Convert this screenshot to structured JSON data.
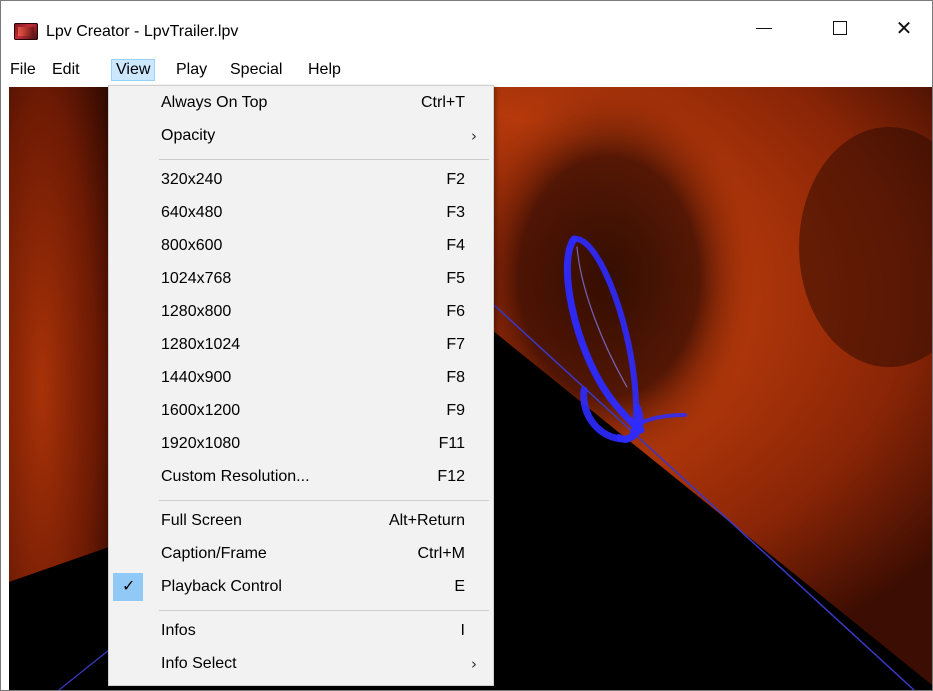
{
  "window": {
    "title": "Lpv Creator - LpvTrailer.lpv",
    "icon": "lpv-app-icon",
    "controls": {
      "minimize": "minimize-icon",
      "maximize": "maximize-icon",
      "close_glyph": "✕"
    }
  },
  "menubar": {
    "items": [
      {
        "label": "File"
      },
      {
        "label": "Edit"
      },
      {
        "label": "View",
        "active": true
      },
      {
        "label": "Play"
      },
      {
        "label": "Special"
      },
      {
        "label": "Help"
      }
    ]
  },
  "view_menu": {
    "items": [
      {
        "label": "Always On Top",
        "shortcut": "Ctrl+T"
      },
      {
        "label": "Opacity",
        "shortcut": "",
        "submenu_glyph": "›"
      },
      {
        "label": "320x240",
        "shortcut": "F2"
      },
      {
        "label": "640x480",
        "shortcut": "F3"
      },
      {
        "label": "800x600",
        "shortcut": "F4"
      },
      {
        "label": "1024x768",
        "shortcut": "F5"
      },
      {
        "label": "1280x800",
        "shortcut": "F6"
      },
      {
        "label": "1280x1024",
        "shortcut": "F7"
      },
      {
        "label": "1440x900",
        "shortcut": "F8"
      },
      {
        "label": "1600x1200",
        "shortcut": "F9"
      },
      {
        "label": "1920x1080",
        "shortcut": "F11"
      },
      {
        "label": "Custom Resolution...",
        "shortcut": "F12"
      },
      {
        "label": "Full Screen",
        "shortcut": "Alt+Return"
      },
      {
        "label": "Caption/Frame",
        "shortcut": "Ctrl+M"
      },
      {
        "label": "Playback Control",
        "shortcut": "E",
        "checked": true,
        "check_glyph": "✓"
      },
      {
        "label": "Infos",
        "shortcut": "I"
      },
      {
        "label": "Info Select",
        "shortcut": "",
        "submenu_glyph": "›"
      }
    ]
  },
  "colors": {
    "menu_bg": "#f2f2f2",
    "menu_highlight": "#cce8ff",
    "check_bg": "#90c8f6",
    "scene_orange": "#b0350c",
    "scene_ring": "#3a2bff"
  }
}
